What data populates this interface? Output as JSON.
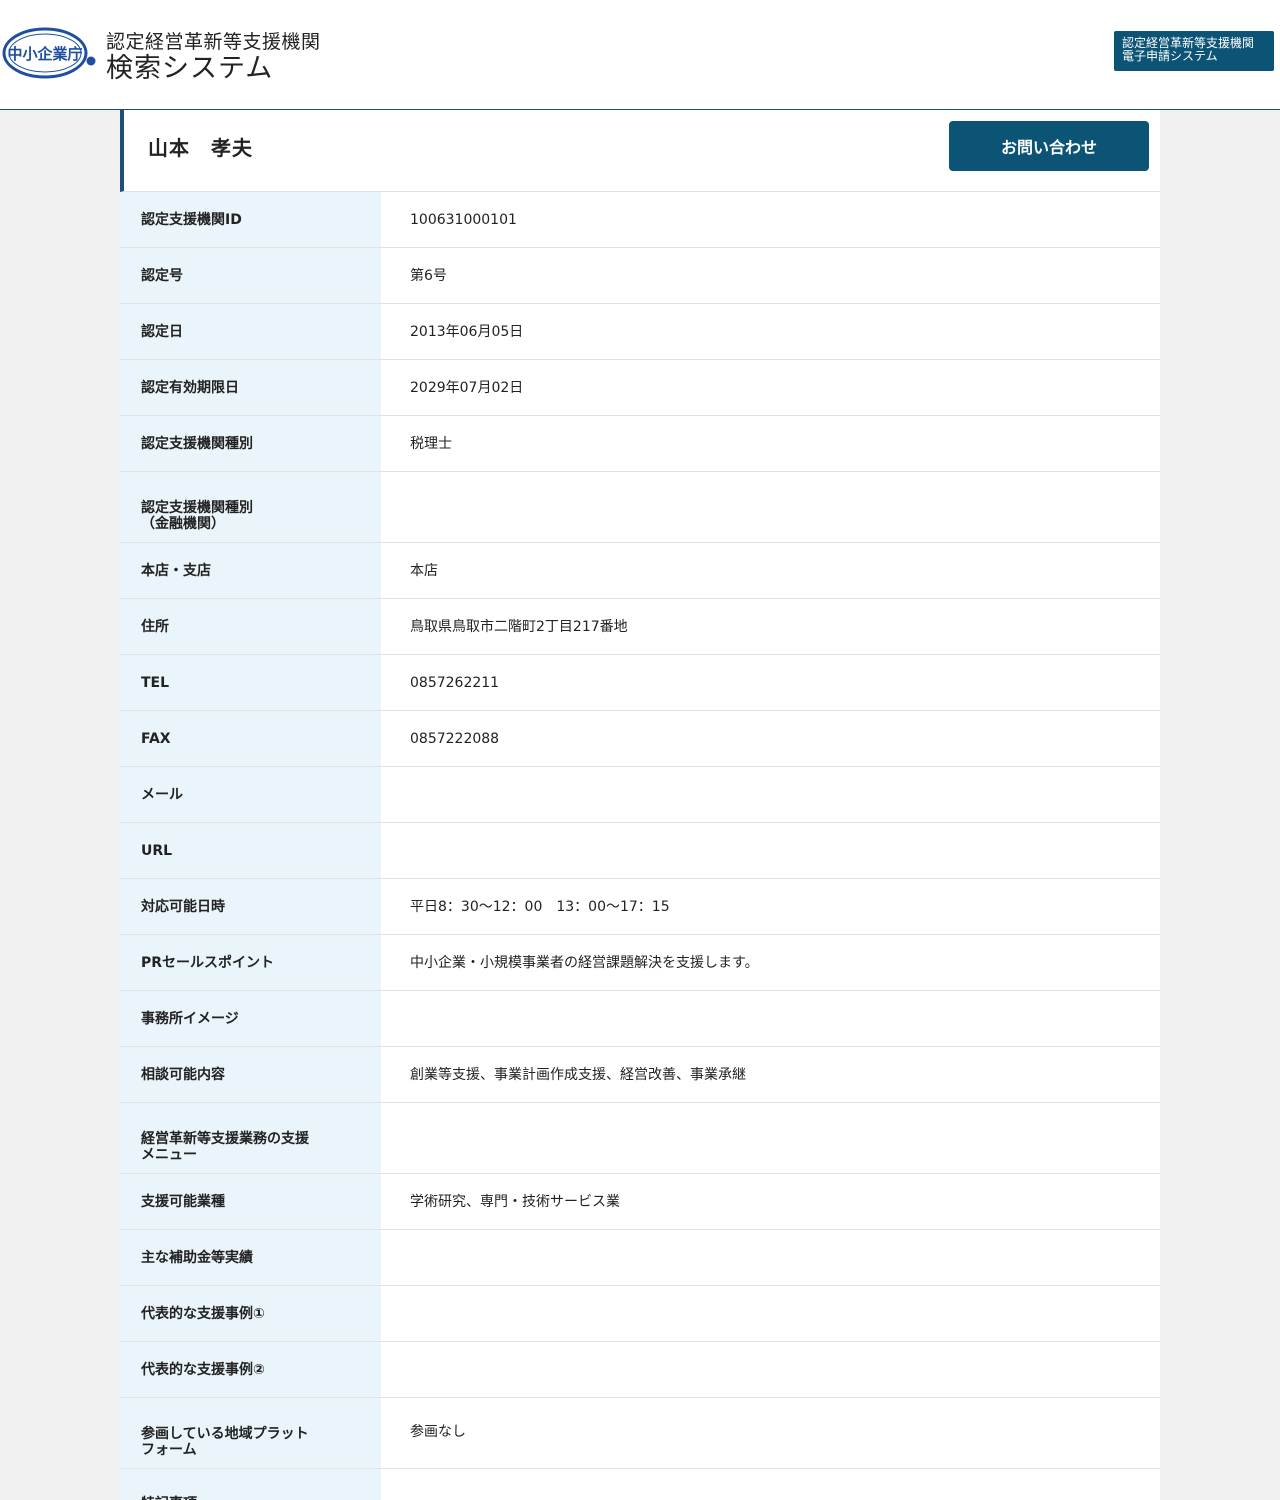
{
  "header": {
    "logo_text": "中小企業庁",
    "title_line1": "認定経営革新等支援機関",
    "title_line2": "検索システム",
    "ext_button_line1": "認定経営革新等支援機関",
    "ext_button_line2": "電子申請システム"
  },
  "colors": {
    "accent": "#0c5476",
    "label_bg": "#eaf5fb",
    "page_bg": "#f0f0f0",
    "border": "#e2e2e2"
  },
  "profile": {
    "name": "山本　孝夫",
    "contact_button": "お問い合わせ"
  },
  "rows": [
    {
      "label": "認定支援機関ID",
      "value": "100631000101"
    },
    {
      "label": "認定号",
      "value": "第6号"
    },
    {
      "label": "認定日",
      "value": "2013年06月05日"
    },
    {
      "label": "認定有効期限日",
      "value": "2029年07月02日"
    },
    {
      "label": "認定支援機関種別",
      "value": "税理士"
    },
    {
      "label": "認定支援機関種別\n（金融機関）",
      "value": ""
    },
    {
      "label": "本店・支店",
      "value": "本店"
    },
    {
      "label": "住所",
      "value": "鳥取県鳥取市二階町2丁目217番地"
    },
    {
      "label": "TEL",
      "value": "0857262211"
    },
    {
      "label": "FAX",
      "value": "0857222088"
    },
    {
      "label": "メール",
      "value": ""
    },
    {
      "label": "URL",
      "value": ""
    },
    {
      "label": "対応可能日時",
      "value": "平日8：30～12：00　13：00～17：15"
    },
    {
      "label": "PRセールスポイント",
      "value": "中小企業・小規模事業者の経営課題解決を支援します。"
    },
    {
      "label": "事務所イメージ",
      "value": ""
    },
    {
      "label": "相談可能内容",
      "value": "創業等支援、事業計画作成支援、経営改善、事業承継"
    },
    {
      "label": "経営革新等支援業務の支援\nメニュー",
      "value": ""
    },
    {
      "label": "支援可能業種",
      "value": "学術研究、専門・技術サービス業"
    },
    {
      "label": "主な補助金等実績",
      "value": ""
    },
    {
      "label": "代表的な支援事例①",
      "value": ""
    },
    {
      "label": "代表的な支援事例②",
      "value": ""
    },
    {
      "label": "参画している地域プラット\nフォーム",
      "value": "参画なし"
    },
    {
      "label": "特記事項",
      "value": ""
    }
  ]
}
